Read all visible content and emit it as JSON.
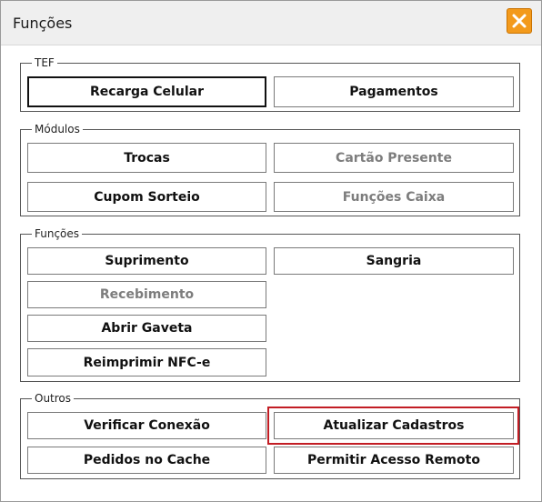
{
  "window": {
    "title": "Funções",
    "close_icon": "close-icon",
    "accent_color": "#f39a1c",
    "highlight_color": "#c21d24"
  },
  "groups": {
    "tef": {
      "legend": "TEF",
      "buttons": {
        "recarga_celular": "Recarga Celular",
        "pagamentos": "Pagamentos"
      }
    },
    "modulos": {
      "legend": "Módulos",
      "buttons": {
        "trocas": "Trocas",
        "cartao_presente": "Cartão Presente",
        "cupom_sorteio": "Cupom Sorteio",
        "funcoes_caixa": "Funções Caixa"
      }
    },
    "funcoes": {
      "legend": "Funções",
      "buttons": {
        "suprimento": "Suprimento",
        "sangria": "Sangria",
        "recebimento": "Recebimento",
        "abrir_gaveta": "Abrir Gaveta",
        "reimprimir_nfce": "Reimprimir NFC-e"
      }
    },
    "outros": {
      "legend": "Outros",
      "buttons": {
        "verificar_conexao": "Verificar Conexão",
        "atualizar_cadastros": "Atualizar Cadastros",
        "pedidos_no_cache": "Pedidos no Cache",
        "permitir_acesso_remoto": "Permitir Acesso Remoto"
      }
    }
  }
}
